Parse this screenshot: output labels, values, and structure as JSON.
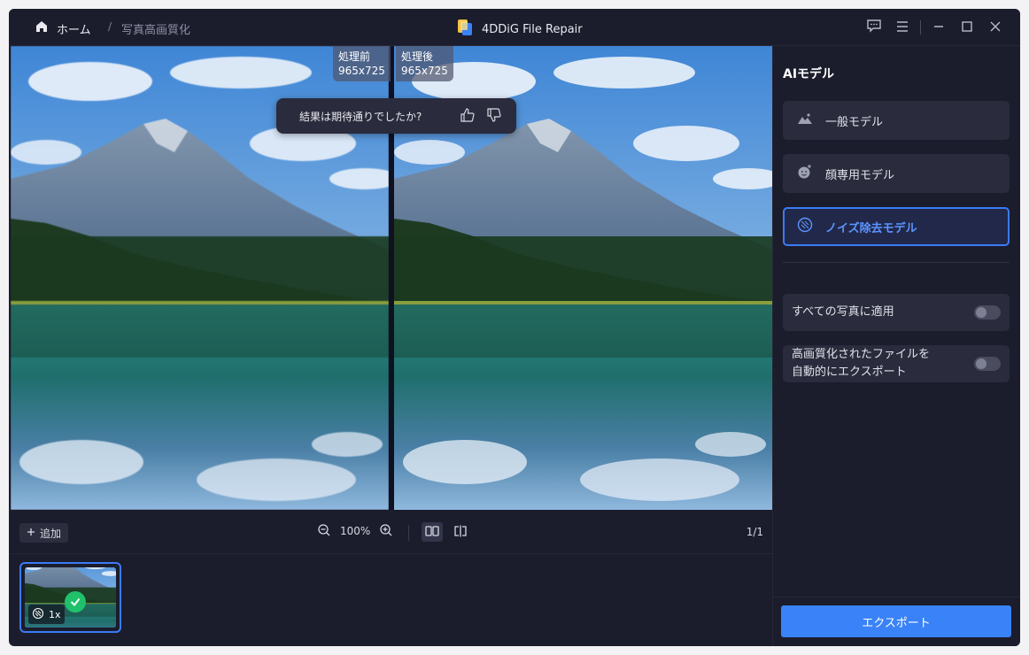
{
  "titlebar": {
    "home_label": "ホーム",
    "breadcrumb_sep": "/",
    "breadcrumb_current": "写真高画質化",
    "app_name": "4DDiG File Repair"
  },
  "preview": {
    "before_label": "処理前",
    "before_size": "965x725",
    "after_label": "処理後",
    "after_size": "965x725",
    "feedback_question": "結果は期待通りでしたか?"
  },
  "toolbar": {
    "add_label": "追加",
    "zoom_level": "100%",
    "page_indicator": "1/1"
  },
  "thumbnails": [
    {
      "scale_label": "1x",
      "selected": true,
      "processed": true
    }
  ],
  "sidebar": {
    "title": "AIモデル",
    "models": [
      {
        "label": "一般モデル",
        "icon": "landscape-icon",
        "active": false
      },
      {
        "label": "顔専用モデル",
        "icon": "face-icon",
        "active": false
      },
      {
        "label": "ノイズ除去モデル",
        "icon": "denoise-icon",
        "active": true
      }
    ],
    "options": [
      {
        "label": "すべての写真に適用",
        "enabled": false
      },
      {
        "label_line1": "高画質化されたファイルを",
        "label_line2": "自動的にエクスポート",
        "enabled": false
      }
    ],
    "export_label": "エクスポート"
  },
  "colors": {
    "accent": "#3a82f7",
    "background": "#1b1c2c",
    "panel": "#2a2c3d",
    "success": "#20c16b"
  }
}
